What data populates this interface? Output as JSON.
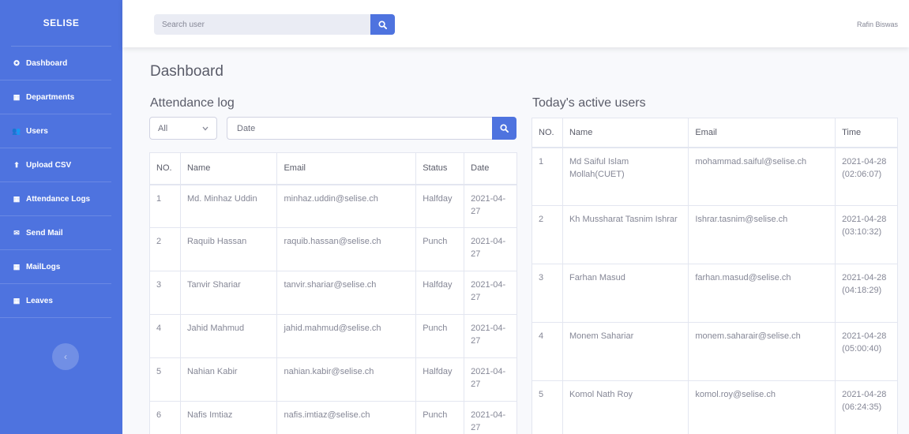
{
  "brand": "SELISE",
  "sidebar": {
    "items": [
      {
        "label": "Dashboard",
        "icon": "tachometer-icon",
        "glyph": "✪"
      },
      {
        "label": "Departments",
        "icon": "building-icon",
        "glyph": "▦"
      },
      {
        "label": "Users",
        "icon": "users-icon",
        "glyph": "👥"
      },
      {
        "label": "Upload CSV",
        "icon": "upload-icon",
        "glyph": "⬆"
      },
      {
        "label": "Attendance Logs",
        "icon": "table-icon",
        "glyph": "▦"
      },
      {
        "label": "Send Mail",
        "icon": "envelope-icon",
        "glyph": "✉"
      },
      {
        "label": "MailLogs",
        "icon": "table-icon",
        "glyph": "▦"
      },
      {
        "label": "Leaves",
        "icon": "table-icon",
        "glyph": "▦"
      }
    ],
    "toggle_glyph": "‹"
  },
  "topbar": {
    "search_placeholder": "Search user",
    "user_name": "Rafin Biswas"
  },
  "page_title": "Dashboard",
  "attendance": {
    "title": "Attendance log",
    "filter_value": "All",
    "date_placeholder": "Date",
    "headers": [
      "NO.",
      "Name",
      "Email",
      "Status",
      "Date"
    ],
    "rows": [
      [
        "1",
        "Md. Minhaz Uddin",
        "minhaz.uddin@selise.ch",
        "Halfday",
        "2021-04-27"
      ],
      [
        "2",
        "Raquib Hassan",
        "raquib.hassan@selise.ch",
        "Punch",
        "2021-04-27"
      ],
      [
        "3",
        "Tanvir Shariar",
        "tanvir.shariar@selise.ch",
        "Halfday",
        "2021-04-27"
      ],
      [
        "4",
        "Jahid Mahmud",
        "jahid.mahmud@selise.ch",
        "Punch",
        "2021-04-27"
      ],
      [
        "5",
        "Nahian Kabir",
        "nahian.kabir@selise.ch",
        "Halfday",
        "2021-04-27"
      ],
      [
        "6",
        "Nafis Imtiaz",
        "nafis.imtiaz@selise.ch",
        "Punch",
        "2021-04-27"
      ]
    ]
  },
  "active_users": {
    "title": "Today's active users",
    "headers": [
      "NO.",
      "Name",
      "Email",
      "Time"
    ],
    "rows": [
      [
        "1",
        "Md Saiful Islam Mollah(CUET)",
        "mohammad.saiful@selise.ch",
        "2021-04-28 (02:06:07)"
      ],
      [
        "2",
        "Kh Mussharat Tasnim Ishrar",
        "Ishrar.tasnim@selise.ch",
        "2021-04-28 (03:10:32)"
      ],
      [
        "3",
        "Farhan Masud",
        "farhan.masud@selise.ch",
        "2021-04-28 (04:18:29)"
      ],
      [
        "4",
        "Monem Sahariar",
        "monem.saharair@selise.ch",
        "2021-04-28 (05:00:40)"
      ],
      [
        "5",
        "Komol Nath Roy",
        "komol.roy@selise.ch",
        "2021-04-28 (06:24:35)"
      ]
    ]
  },
  "colors": {
    "sidebar": "#4e73df",
    "accent": "#4e73df",
    "background": "#f8f9fc",
    "text": "#858796",
    "heading": "#5a5c69"
  }
}
